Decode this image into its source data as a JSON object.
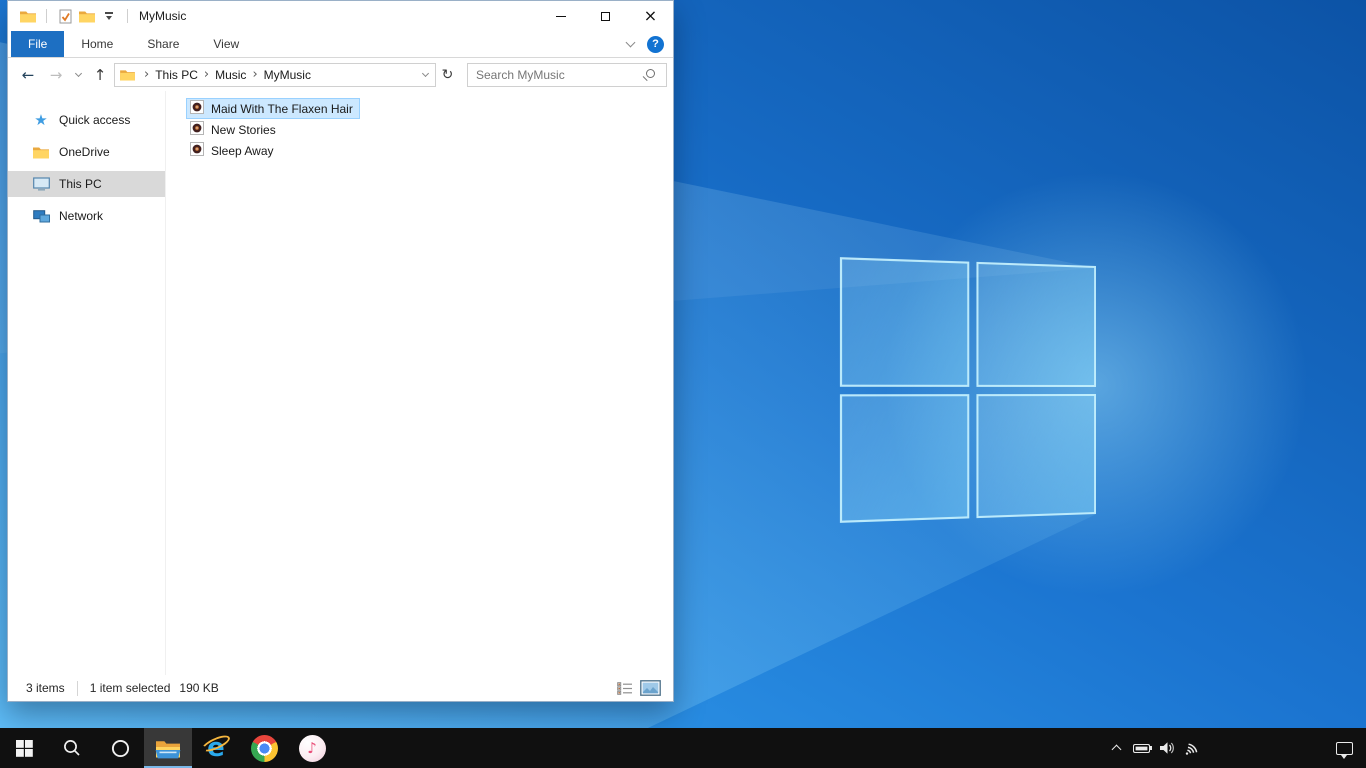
{
  "window": {
    "title": "MyMusic",
    "ribbon": {
      "tabs": [
        {
          "label": "File",
          "active": true
        },
        {
          "label": "Home",
          "active": false
        },
        {
          "label": "Share",
          "active": false
        },
        {
          "label": "View",
          "active": false
        }
      ]
    },
    "breadcrumb": {
      "items": [
        {
          "label": "This PC"
        },
        {
          "label": "Music"
        },
        {
          "label": "MyMusic"
        }
      ]
    },
    "search": {
      "placeholder": "Search MyMusic"
    },
    "sidebar": {
      "items": [
        {
          "label": "Quick access",
          "icon": "quick-access-star-icon",
          "selected": false
        },
        {
          "label": "OneDrive",
          "icon": "folder-icon",
          "selected": false
        },
        {
          "label": "This PC",
          "icon": "this-pc-monitor-icon",
          "selected": true
        },
        {
          "label": "Network",
          "icon": "network-icon",
          "selected": false
        }
      ]
    },
    "files": {
      "items": [
        {
          "name": "Maid With The Flaxen Hair",
          "icon": "audio-file-icon",
          "selected": true
        },
        {
          "name": "New Stories",
          "icon": "audio-file-icon",
          "selected": false
        },
        {
          "name": "Sleep Away",
          "icon": "audio-file-icon",
          "selected": false
        }
      ]
    },
    "statusbar": {
      "item_count": "3 items",
      "selection": "1 item selected",
      "selection_size": "190 KB"
    }
  },
  "taskbar": {
    "apps": [
      {
        "name": "start"
      },
      {
        "name": "search"
      },
      {
        "name": "cortana"
      },
      {
        "name": "file-explorer",
        "active": true
      },
      {
        "name": "internet-explorer"
      },
      {
        "name": "chrome"
      },
      {
        "name": "itunes"
      }
    ],
    "tray": [
      "hidden-icons",
      "battery",
      "volume",
      "network",
      "action-center"
    ]
  },
  "glyphs": {
    "close": "×",
    "help": "?",
    "back": "←",
    "forward": "→",
    "up": "↑",
    "refresh": "↻",
    "crumb_sep": "›",
    "star": "★",
    "note": "♪",
    "ie": "e"
  },
  "colors": {
    "file_tab_blue": "#1d6fc2",
    "selection_fill": "#cce8ff",
    "selection_border": "#99d1ff",
    "sidebar_selected": "#d9d9d9",
    "taskbar_bg": "#101010",
    "taskbar_active_underline": "#7ab8e8",
    "wallpaper_light": "#37a7f5",
    "wallpaper_dark": "#0c53a6",
    "folder_yellow": "#ffd45f"
  }
}
